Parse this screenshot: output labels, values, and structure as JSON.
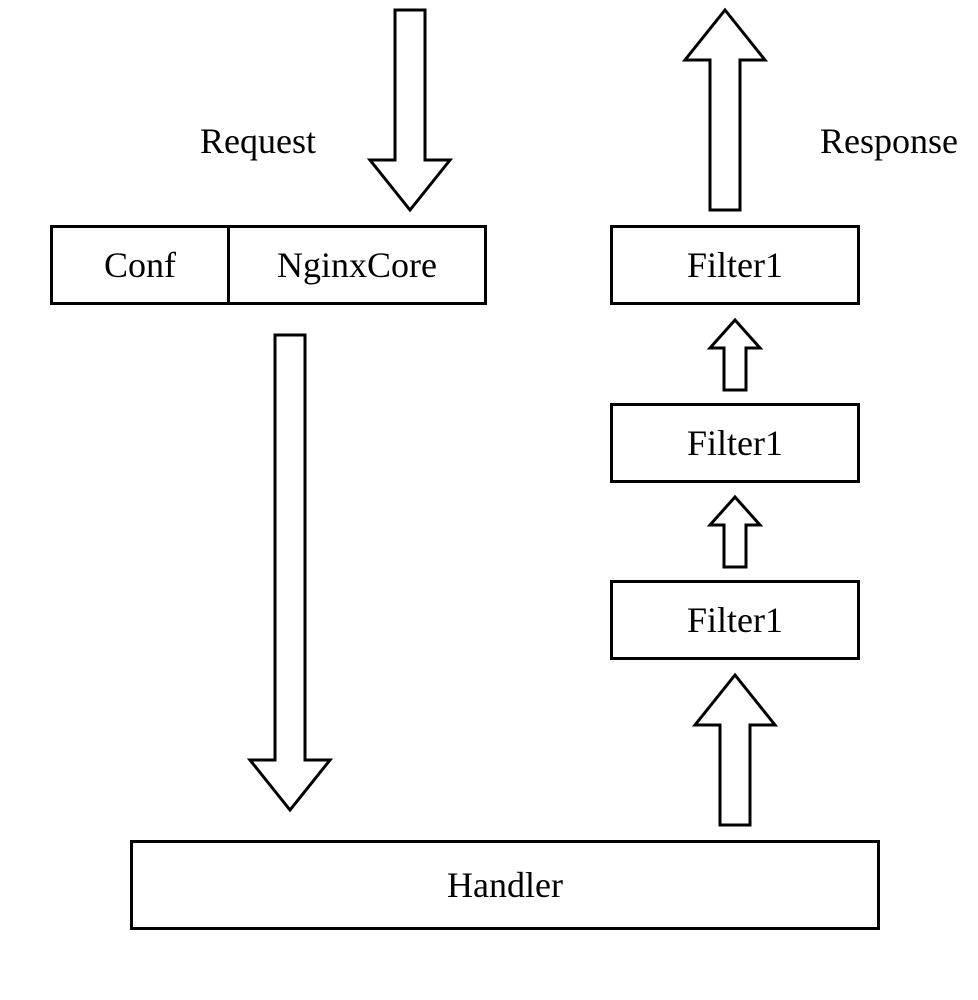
{
  "labels": {
    "request": "Request",
    "response": "Response"
  },
  "boxes": {
    "conf": "Conf",
    "nginxcore": "NginxCore",
    "filter_top": "Filter1",
    "filter_mid": "Filter1",
    "filter_bottom": "Filter1",
    "handler": "Handler"
  }
}
